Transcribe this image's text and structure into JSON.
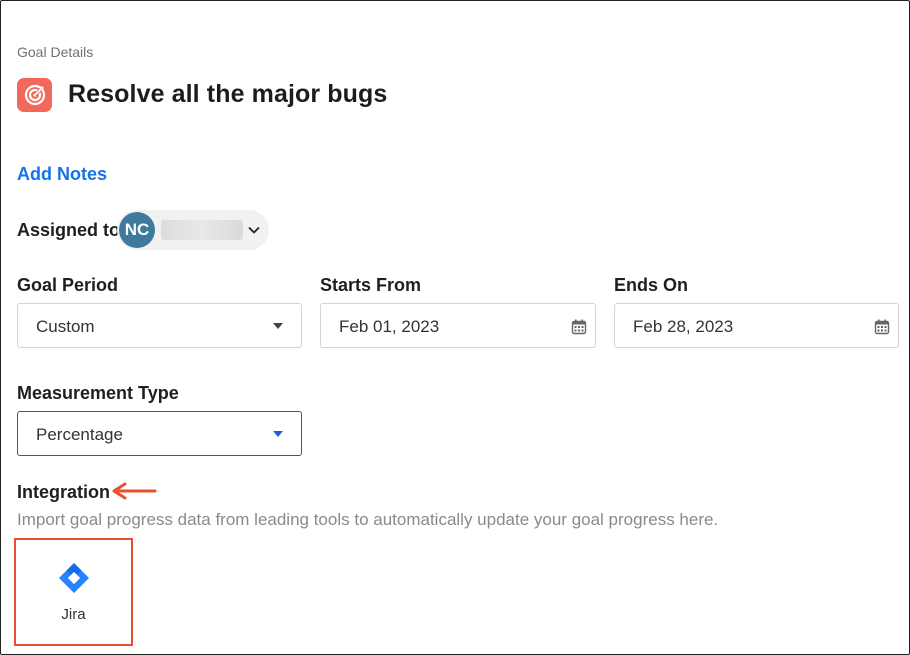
{
  "breadcrumb": "Goal Details",
  "goal": {
    "title": "Resolve all the major bugs",
    "icon": "target-icon",
    "icon_color": "#f2685b"
  },
  "actions": {
    "add_notes": "Add Notes"
  },
  "assignment": {
    "label": "Assigned to",
    "avatar_initials": "NC",
    "avatar_color": "#3e7a9e"
  },
  "period": {
    "goal_period_label": "Goal Period",
    "goal_period_value": "Custom",
    "starts_label": "Starts From",
    "starts_value": "Feb 01, 2023",
    "ends_label": "Ends On",
    "ends_value": "Feb 28, 2023"
  },
  "measurement": {
    "label": "Measurement Type",
    "value": "Percentage"
  },
  "integration": {
    "label": "Integration",
    "description": "Import goal progress data from leading tools to automatically update your goal progress here.",
    "tools": [
      {
        "name": "Jira",
        "icon": "jira-icon",
        "color": "#2684ff"
      }
    ],
    "highlight_color": "#e8502c"
  },
  "colors": {
    "link": "#1473e6",
    "active_border": "#1d5fa8"
  }
}
